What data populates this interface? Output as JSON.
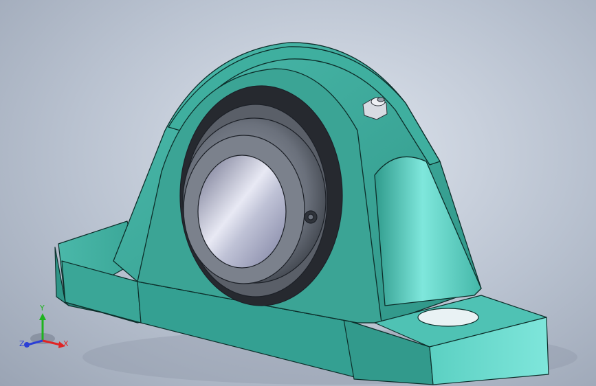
{
  "viewport": {
    "model": "pillow-block-bearing",
    "colors": {
      "background_top": "#dfe5ee",
      "background_bottom": "#9aa4b4",
      "housing": "#3aa697",
      "housing_light": "#58cbbb",
      "housing_dark": "#2b8378",
      "insert_outer": "#5f6570",
      "insert_inner": "#c9ccd8",
      "edge": "#0c2e2a"
    }
  },
  "triad": {
    "x_label": "X",
    "y_label": "Y",
    "z_label": "Z",
    "x_color": "#e02424",
    "y_color": "#1fb31f",
    "z_color": "#2b3fd6"
  }
}
